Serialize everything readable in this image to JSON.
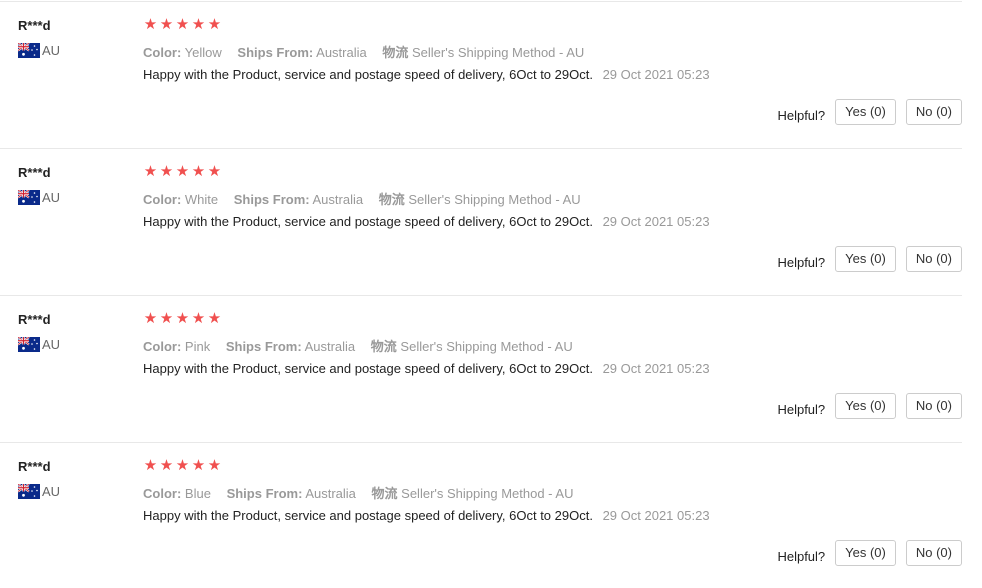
{
  "reviews": [
    {
      "user": "R***d",
      "country": "AU",
      "rating_stars": 5,
      "color_label": "Color:",
      "color_value": "Yellow",
      "ships_label": "Ships From:",
      "ships_value": "Australia",
      "logistics_label": "物流",
      "logistics_value": "Seller's Shipping Method - AU",
      "text": "Happy with the Product, service and postage speed of delivery, 6Oct to 29Oct.",
      "date": "29 Oct 2021 05:23",
      "helpful_label": "Helpful?",
      "yes_label": "Yes (0)",
      "no_label": "No (0)"
    },
    {
      "user": "R***d",
      "country": "AU",
      "rating_stars": 5,
      "color_label": "Color:",
      "color_value": "White",
      "ships_label": "Ships From:",
      "ships_value": "Australia",
      "logistics_label": "物流",
      "logistics_value": "Seller's Shipping Method - AU",
      "text": "Happy with the Product, service and postage speed of delivery, 6Oct to 29Oct.",
      "date": "29 Oct 2021 05:23",
      "helpful_label": "Helpful?",
      "yes_label": "Yes (0)",
      "no_label": "No (0)"
    },
    {
      "user": "R***d",
      "country": "AU",
      "rating_stars": 5,
      "color_label": "Color:",
      "color_value": "Pink",
      "ships_label": "Ships From:",
      "ships_value": "Australia",
      "logistics_label": "物流",
      "logistics_value": "Seller's Shipping Method - AU",
      "text": "Happy with the Product, service and postage speed of delivery, 6Oct to 29Oct.",
      "date": "29 Oct 2021 05:23",
      "helpful_label": "Helpful?",
      "yes_label": "Yes (0)",
      "no_label": "No (0)"
    },
    {
      "user": "R***d",
      "country": "AU",
      "rating_stars": 5,
      "color_label": "Color:",
      "color_value": "Blue",
      "ships_label": "Ships From:",
      "ships_value": "Australia",
      "logistics_label": "物流",
      "logistics_value": "Seller's Shipping Method - AU",
      "text": "Happy with the Product, service and postage speed of delivery, 6Oct to 29Oct.",
      "date": "29 Oct 2021 05:23",
      "helpful_label": "Helpful?",
      "yes_label": "Yes (0)",
      "no_label": "No (0)"
    }
  ],
  "colors": {
    "star": "#f0504f",
    "muted_text": "#999999",
    "body_text": "#222222",
    "divider": "#e8e8e8"
  },
  "icons": {
    "flag": "australia-flag-icon",
    "star": "star-icon"
  }
}
